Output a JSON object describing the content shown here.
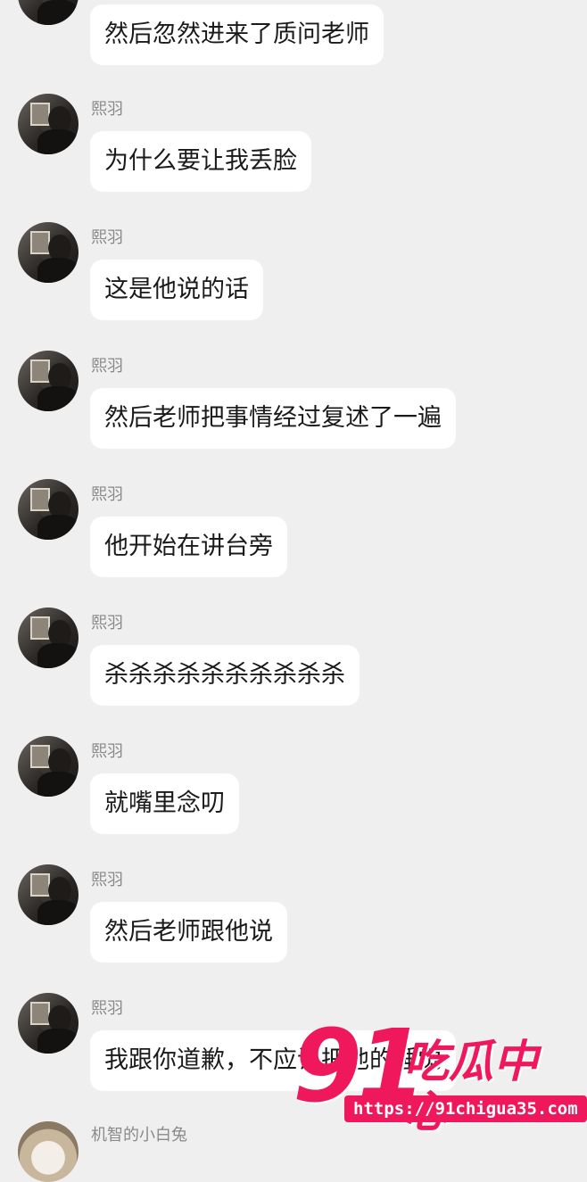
{
  "colors": {
    "background": "#efeff0",
    "bubble": "#ffffff",
    "name_text": "#8a8a8a",
    "watermark": "#f0185d"
  },
  "messages": [
    {
      "sender": "",
      "text": "然后忽然进来了质问老师"
    },
    {
      "sender": "熙羽",
      "text": "为什么要让我丢脸"
    },
    {
      "sender": "熙羽",
      "text": "这是他说的话"
    },
    {
      "sender": "熙羽",
      "text": "然后老师把事情经过复述了一遍"
    },
    {
      "sender": "熙羽",
      "text": "他开始在讲台旁"
    },
    {
      "sender": "熙羽",
      "text": "杀杀杀杀杀杀杀杀杀杀"
    },
    {
      "sender": "熙羽",
      "text": "就嘴里念叨"
    },
    {
      "sender": "熙羽",
      "text": "然后老师跟他说"
    },
    {
      "sender": "熙羽",
      "text": "我跟你道歉，不应该把他的睡觉"
    },
    {
      "sender": "机智的小白兔",
      "text": ""
    }
  ],
  "watermark": {
    "number": "91",
    "title": "吃瓜中心",
    "url": "https://91chigua35.com"
  }
}
